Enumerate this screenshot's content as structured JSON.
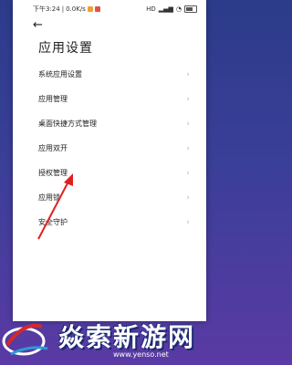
{
  "status": {
    "time": "下午3:24",
    "speed": "0.0K/s",
    "right_icons": [
      "hd-icon",
      "signal-icon",
      "wifi-icon",
      "battery-icon"
    ]
  },
  "header": {
    "back_label": "←",
    "title": "应用设置"
  },
  "menu": {
    "items": [
      {
        "label": "系统应用设置"
      },
      {
        "label": "应用管理"
      },
      {
        "label": "桌面快捷方式管理"
      },
      {
        "label": "应用双开"
      },
      {
        "label": "授权管理"
      },
      {
        "label": "应用锁"
      },
      {
        "label": "安全守护"
      }
    ],
    "chevron": "›"
  },
  "watermark": {
    "brand": "焱索新游网",
    "url": "www.yenso.net"
  },
  "colors": {
    "annotation_arrow": "#e02020",
    "background_top": "#2c3b8a",
    "background_bottom": "#5a3aa4"
  }
}
